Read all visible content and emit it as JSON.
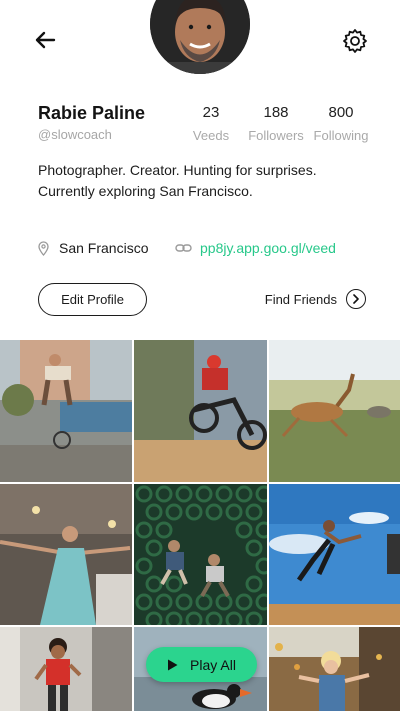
{
  "profile": {
    "name": "Rabie Paline",
    "handle": "@slowcoach",
    "bio_line1": "Photographer. Creator. Hunting for surprises.",
    "bio_line2": "Currently exploring San Francisco.",
    "location": "San Francisco",
    "link": "pp8jy.app.goo.gl/veed"
  },
  "stats": [
    {
      "value": "23",
      "label": "Veeds"
    },
    {
      "value": "188",
      "label": "Followers"
    },
    {
      "value": "800",
      "label": "Following"
    }
  ],
  "actions": {
    "edit_profile": "Edit Profile",
    "find_friends": "Find Friends",
    "play_all": "Play All"
  },
  "icons": {
    "back": "arrow-left-icon",
    "settings": "gear-icon",
    "location": "pin-icon",
    "link": "chain-link-icon",
    "find_friends": "chevron-right-circle-icon",
    "play": "play-icon"
  },
  "colors": {
    "accent": "#2bd48e",
    "link": "#27c88a",
    "muted": "#a6a6a6"
  },
  "photos": [
    {
      "subject": "bmx-rider-jump"
    },
    {
      "subject": "mountain-biker"
    },
    {
      "subject": "leaping-antelope"
    },
    {
      "subject": "dancer-in-blue-dress"
    },
    {
      "subject": "kids-on-green-pipes"
    },
    {
      "subject": "jumping-woman-sky"
    },
    {
      "subject": "child-in-red"
    },
    {
      "subject": "puffin"
    },
    {
      "subject": "boy-with-leaves"
    }
  ]
}
